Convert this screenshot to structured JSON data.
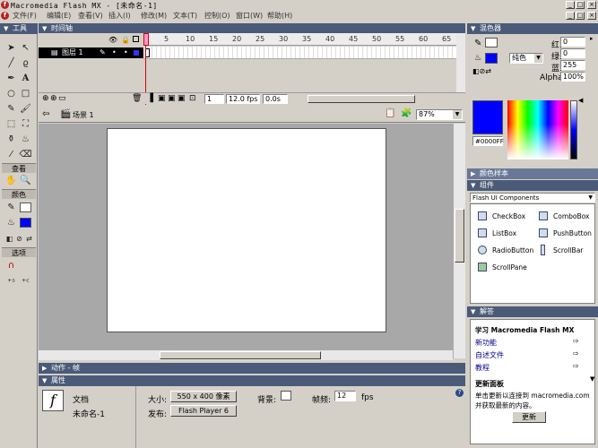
{
  "window": {
    "title": "Macromedia Flash MX - [未命名-1]",
    "min": "_",
    "max": "□",
    "close": "×"
  },
  "menu": [
    "文件(F)",
    "编辑(E)",
    "查看(V)",
    "插入(I)",
    "修改(M)",
    "文本(T)",
    "控制(O)",
    "窗口(W)",
    "帮助(H)"
  ],
  "tools": {
    "title": "工具",
    "view_label": "查看",
    "colors_label": "颜色",
    "options_label": "选项"
  },
  "timeline": {
    "title": "时间轴",
    "ruler": [
      "5",
      "10",
      "15",
      "20",
      "25",
      "30",
      "35",
      "40",
      "45",
      "50",
      "55",
      "60",
      "65"
    ],
    "layer_name": "图层 1",
    "frame": "1",
    "fps": "12.0 fps",
    "time": "0.0s"
  },
  "scene": {
    "name": "场景 1",
    "zoom": "87%"
  },
  "actions_panel": {
    "title": "动作 - 帧"
  },
  "properties": {
    "title": "属性",
    "doc_type": "文档",
    "doc_name": "未命名-1",
    "size_label": "大小:",
    "size_value": "550 x 400 像素",
    "publish_label": "发布:",
    "publish_value": "Flash Player 6",
    "bg_label": "背景:",
    "fps_label": "帧频:",
    "fps_value": "12",
    "fps_unit": "fps"
  },
  "mixer": {
    "title": "混色器",
    "r_label": "红:",
    "r": "0",
    "g_label": "绿:",
    "g": "0",
    "b_label": "蓝:",
    "b": "255",
    "alpha_label": "Alpha:",
    "alpha": "100%",
    "fill_type": "纯色",
    "hex": "#0000FF",
    "accent": "#0000ff"
  },
  "swatches": {
    "title": "颜色样本"
  },
  "components": {
    "title": "组件",
    "set": "Flash UI Components",
    "items": [
      "CheckBox",
      "ComboBox",
      "ListBox",
      "PushButton",
      "RadioButton",
      "ScrollBar",
      "ScrollPane"
    ]
  },
  "answers": {
    "title": "解答",
    "learn_title": "学习 Macromedia Flash MX",
    "links": [
      "新功能",
      "自述文件",
      "教程"
    ],
    "update_title": "更新面板",
    "update_text": "单击更新以连接到 macromedia.com 并获取最新的内容。",
    "update_button": "更新"
  }
}
